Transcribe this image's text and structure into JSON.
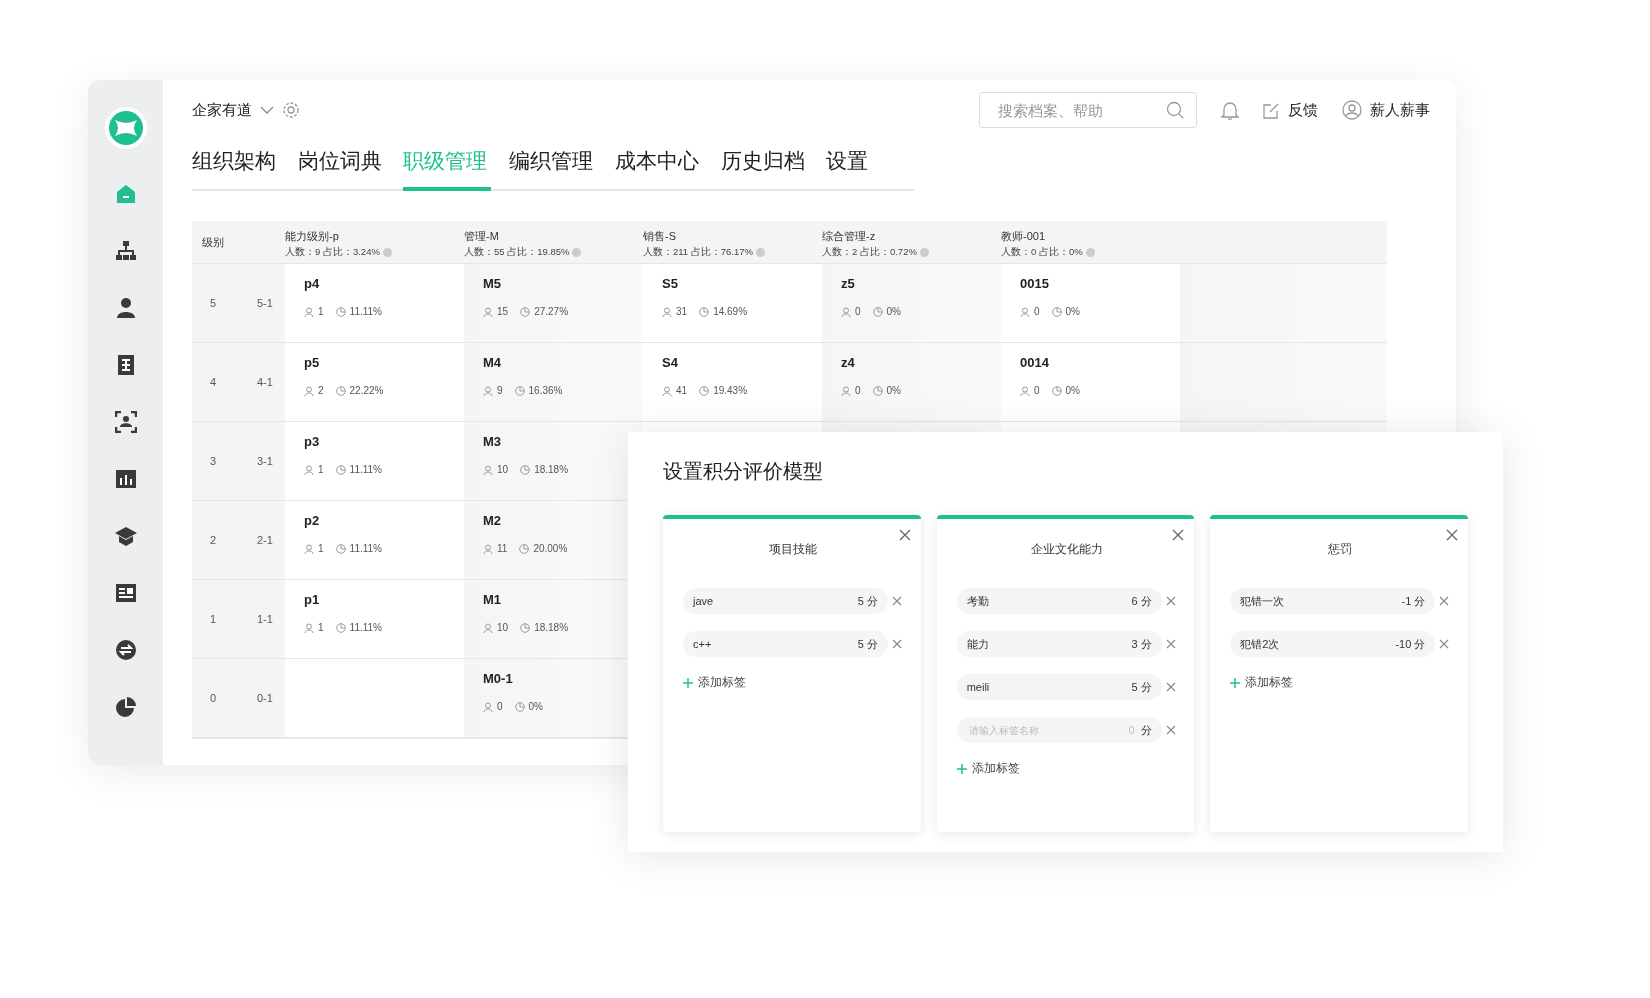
{
  "header": {
    "company": "企家有道",
    "search": {
      "placeholder": "搜索档案、帮助"
    },
    "feedback": "反馈",
    "user": "薪人薪事"
  },
  "sidebar": {
    "items": [
      {
        "selected": true
      },
      {
        "selected": false
      },
      {
        "selected": false
      },
      {
        "selected": false
      },
      {
        "selected": false
      },
      {
        "selected": false
      },
      {
        "selected": false
      },
      {
        "selected": false
      },
      {
        "selected": false
      },
      {
        "selected": false
      }
    ]
  },
  "tabs": [
    {
      "label": "组织架构",
      "selected": false
    },
    {
      "label": "岗位词典",
      "selected": false
    },
    {
      "label": "职级管理",
      "selected": true
    },
    {
      "label": "编织管理",
      "selected": false
    },
    {
      "label": "成本中心",
      "selected": false
    },
    {
      "label": "历史归档",
      "selected": false
    },
    {
      "label": "设置",
      "selected": false
    }
  ],
  "table": {
    "level_heading": "级别",
    "columns": [
      {
        "title": "能力级别-p",
        "stats": "人数：9 占比：3.24%"
      },
      {
        "title": "管理-M",
        "stats": "人数：55 占比：19.85%"
      },
      {
        "title": "销售-S",
        "stats": "人数：211 占比：76.17%"
      },
      {
        "title": "综合管理-z",
        "stats": "人数：2 占比：0.72%"
      },
      {
        "title": "教师-001",
        "stats": "人数：0 占比：0%"
      }
    ],
    "rows": [
      {
        "level": "5",
        "sub": "5-1",
        "cells": [
          {
            "kind": "grade",
            "name": "p4",
            "count": "1",
            "share": "11.11%"
          },
          {
            "kind": "grade",
            "name": "M5",
            "count": "15",
            "share": "27.27%"
          },
          {
            "kind": "grade",
            "name": "S5",
            "count": "31",
            "share": "14.69%"
          },
          {
            "kind": "grade",
            "name": "z5",
            "count": "0",
            "share": "0%"
          },
          {
            "kind": "grade",
            "name": "0015",
            "count": "0",
            "share": "0%"
          }
        ]
      },
      {
        "level": "4",
        "sub": "4-1",
        "cells": [
          {
            "kind": "grade",
            "name": "p5",
            "count": "2",
            "share": "22.22%"
          },
          {
            "kind": "grade",
            "name": "M4",
            "count": "9",
            "share": "16.36%"
          },
          {
            "kind": "grade",
            "name": "S4",
            "count": "41",
            "share": "19.43%"
          },
          {
            "kind": "grade",
            "name": "z4",
            "count": "0",
            "share": "0%"
          },
          {
            "kind": "grade",
            "name": "0014",
            "count": "0",
            "share": "0%"
          }
        ]
      },
      {
        "level": "3",
        "sub": "3-1",
        "cells": [
          {
            "kind": "grade",
            "name": "p3",
            "count": "1",
            "share": "11.11%"
          },
          {
            "kind": "grade",
            "name": "M3",
            "count": "10",
            "share": "18.18%"
          }
        ]
      },
      {
        "level": "2",
        "sub": "2-1",
        "cells": [
          {
            "kind": "grade",
            "name": "p2",
            "count": "1",
            "share": "11.11%"
          },
          {
            "kind": "grade",
            "name": "M2",
            "count": "11",
            "share": "20.00%"
          }
        ]
      },
      {
        "level": "1",
        "sub": "1-1",
        "cells": [
          {
            "kind": "grade",
            "name": "p1",
            "count": "1",
            "share": "11.11%"
          },
          {
            "kind": "grade",
            "name": "M1",
            "count": "10",
            "share": "18.18%"
          }
        ]
      },
      {
        "level": "0",
        "sub": "0-1",
        "cells": [
          {
            "kind": "empty"
          },
          {
            "kind": "grade",
            "name": "M0-1",
            "count": "0",
            "share": "0%"
          }
        ]
      }
    ]
  },
  "dialog": {
    "title": "设置积分评价模型",
    "cards": [
      {
        "title": "项目技能",
        "items": [
          {
            "kind": "tag",
            "name": "jave",
            "score": "5 分"
          },
          {
            "kind": "tag",
            "name": "c++",
            "score": "5 分"
          }
        ],
        "add": "添加标签"
      },
      {
        "title": "企业文化能力",
        "items": [
          {
            "kind": "tag",
            "name": "考勤",
            "score": "6 分"
          },
          {
            "kind": "tag",
            "name": "能力",
            "score": "3 分"
          },
          {
            "kind": "tag",
            "name": "meili",
            "score": "5 分"
          },
          {
            "kind": "input",
            "placeholder": "请输入标签名称",
            "score_placeholder": "0",
            "unit": "分"
          }
        ],
        "add": "添加标签"
      },
      {
        "title": "惩罚",
        "items": [
          {
            "kind": "tag",
            "name": "犯错一次",
            "score": "-1 分"
          },
          {
            "kind": "tag",
            "name": "犯错2次",
            "score": "-10 分"
          }
        ],
        "add": "添加标签"
      }
    ]
  }
}
